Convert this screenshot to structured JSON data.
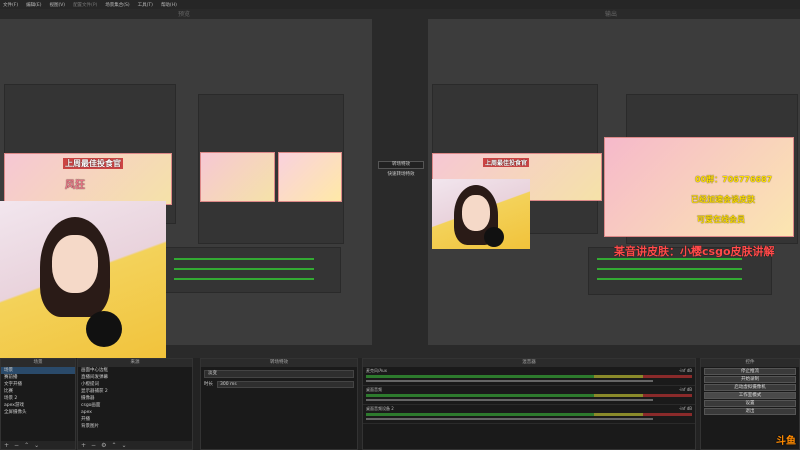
{
  "menu": [
    "文件(F)",
    "编辑(E)",
    "视图(V)",
    "配置文件(P)",
    "场景集合(S)",
    "工具(T)",
    "帮助(H)"
  ],
  "preview_title": "预览",
  "program_title": "输出",
  "transition_mid": {
    "btn1": "转场特效",
    "quick": "快速转场特效"
  },
  "overlay": {
    "banner": "上周最佳投食官",
    "name": "风狂",
    "program_banner1": "上周最佳投食官",
    "program_red": "某音讲皮肤：小樱csgo皮肤讲解",
    "program_yellow1": "00群：706776687",
    "program_yellow2": "可爱在线会员",
    "program_yellow3": "已经加速会谈皮肤"
  },
  "scenes": {
    "title": "场景",
    "items": [
      "场景",
      "赛前播",
      "文字开播",
      "比赛",
      "场景 2",
      "apex游戏",
      "全屏摄像头"
    ],
    "selected_index": 0
  },
  "sources": {
    "title": "来源",
    "items": [
      "画面中心边框",
      "直播间发弹幕",
      "小橙提词",
      "显示器捕获 2",
      "摄像器",
      "csgo画面",
      "apex",
      "开播",
      "背景图片"
    ]
  },
  "transitions": {
    "title": "转场特效",
    "type": "淡变",
    "duration_label": "时长",
    "duration": "300 ms"
  },
  "mixer": {
    "title": "混音器",
    "channels": [
      {
        "name": "麦克风/Aux",
        "db": "-inf dB"
      },
      {
        "name": "桌面音频",
        "db": "-inf dB"
      },
      {
        "name": "桌面音频设备 2",
        "db": "-inf dB"
      }
    ]
  },
  "controls": {
    "title": "控件",
    "buttons": [
      "停止推流",
      "开始录制",
      "启动虚拟摄像机",
      "工作室模式",
      "设置",
      "退出"
    ]
  },
  "watermark": "斗鱼"
}
